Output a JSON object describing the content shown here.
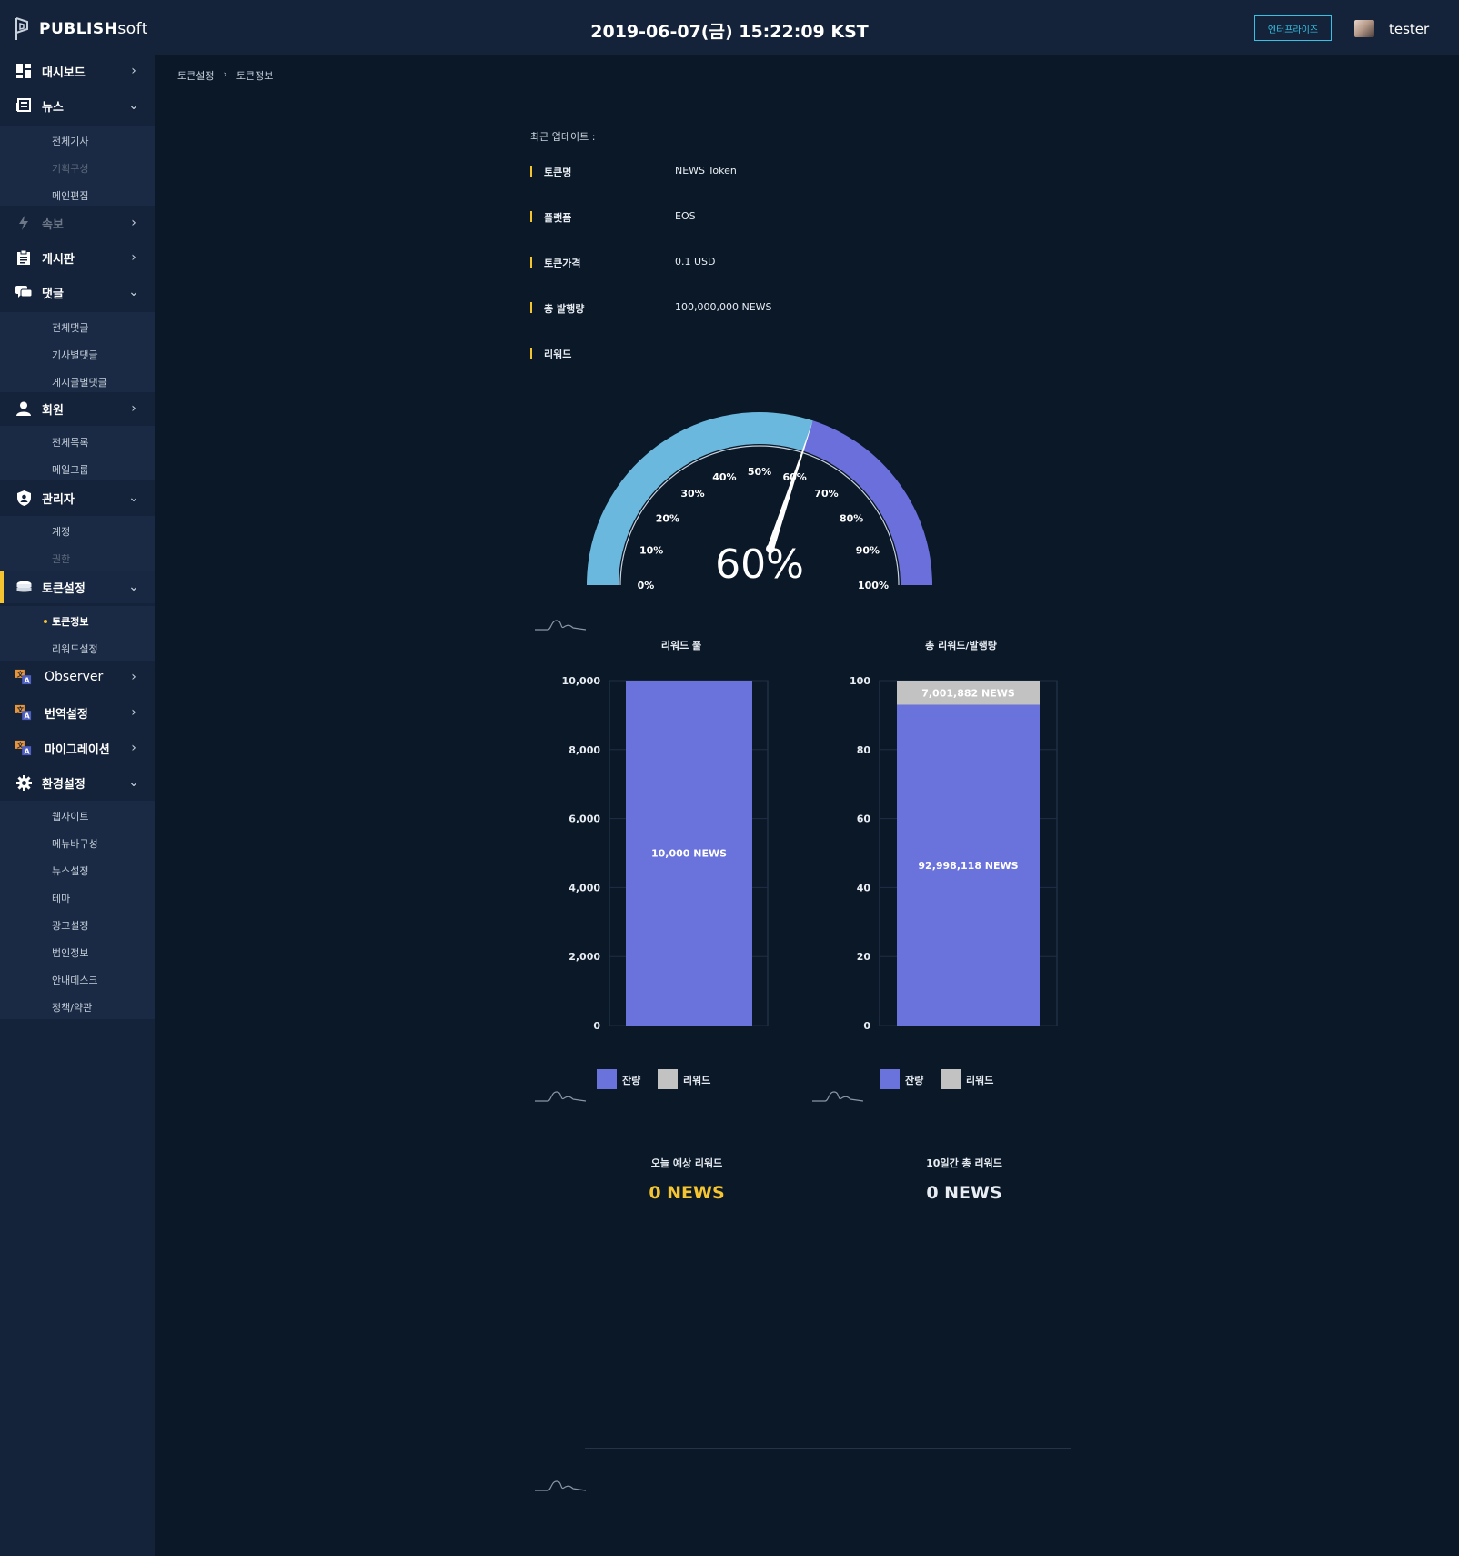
{
  "header": {
    "logo_text_bold": "PUBLISH",
    "logo_text_light": "soft",
    "datetime": "2019-06-07(금) 15:22:09 KST",
    "enterprise_label": "엔터프라이즈",
    "username": "tester"
  },
  "sidebar": {
    "items": [
      {
        "label": "대시보드",
        "icon": "dashboard-icon",
        "chevron": "right"
      },
      {
        "label": "뉴스",
        "icon": "newspaper-icon",
        "chevron": "down",
        "subs": [
          "전체기사",
          "기획구성",
          "메인편집"
        ]
      },
      {
        "label": "속보",
        "icon": "lightning-icon",
        "chevron": "right"
      },
      {
        "label": "게시판",
        "icon": "clipboard-icon",
        "chevron": "right"
      },
      {
        "label": "댓글",
        "icon": "comments-icon",
        "chevron": "down",
        "subs": [
          "전체댓글",
          "기사별댓글",
          "게시글별댓글"
        ]
      },
      {
        "label": "회원",
        "icon": "user-icon",
        "chevron": "right",
        "subs": [
          "전체목록",
          "메일그룹"
        ]
      },
      {
        "label": "관리자",
        "icon": "shield-icon",
        "chevron": "down",
        "subs": [
          "계정",
          "권한"
        ]
      },
      {
        "label": "토큰설정",
        "icon": "coins-icon",
        "chevron": "down",
        "subs": [
          "토큰정보",
          "리워드설정"
        ]
      },
      {
        "label": "Observer",
        "icon": "translate-icon",
        "chevron": "right"
      },
      {
        "label": "번역설정",
        "icon": "translate-icon",
        "chevron": "right"
      },
      {
        "label": "마이그레이션",
        "icon": "translate-icon",
        "chevron": "right"
      },
      {
        "label": "환경설정",
        "icon": "gear-icon",
        "chevron": "down",
        "subs": [
          "웹사이트",
          "메뉴바구성",
          "뉴스설정",
          "테마",
          "광고설정",
          "법인정보",
          "안내데스크",
          "정책/약관"
        ]
      }
    ]
  },
  "breadcrumb": [
    "토큰설정",
    "토큰정보"
  ],
  "token": {
    "updated_label": "최근 업데이트 :",
    "rows": [
      {
        "key": "토큰명",
        "value": "NEWS Token"
      },
      {
        "key": "플랫폼",
        "value": "EOS"
      },
      {
        "key": "토큰가격",
        "value": "0.1 USD"
      },
      {
        "key": "총 발행량",
        "value": "100,000,000 NEWS"
      },
      {
        "key": "리워드",
        "value": ""
      }
    ]
  },
  "colors": {
    "accent_yellow": "#f5c431",
    "gauge_light": "#6ab8dd",
    "gauge_dark": "#6a6fdc",
    "bar_blue": "#6a72dc",
    "bar_grey": "#c2c2c2",
    "enterprise_cyan": "#35c3e5"
  },
  "chart_data": [
    {
      "type": "gauge",
      "value": 60,
      "value_label": "60%",
      "ticks": [
        "0%",
        "10%",
        "20%",
        "30%",
        "40%",
        "50%",
        "60%",
        "70%",
        "80%",
        "90%",
        "100%"
      ],
      "min": 0,
      "max": 100
    },
    {
      "type": "bar",
      "title": "리워드 풀",
      "categories": [
        ""
      ],
      "series": [
        {
          "name": "잔량",
          "values": [
            10000
          ],
          "label": "10,000 NEWS"
        },
        {
          "name": "리워드",
          "values": [
            0
          ]
        }
      ],
      "ylim": [
        0,
        10000
      ],
      "yticks": [
        "0",
        "2,000",
        "4,000",
        "6,000",
        "8,000",
        "10,000"
      ],
      "legend": [
        "잔량",
        "리워드"
      ]
    },
    {
      "type": "bar",
      "title": "총 리워드/발행량",
      "categories": [
        ""
      ],
      "series": [
        {
          "name": "잔량",
          "values": [
            92.998118
          ],
          "label": "92,998,118 NEWS"
        },
        {
          "name": "리워드",
          "values": [
            7.001882
          ],
          "label": "7,001,882 NEWS"
        }
      ],
      "ylim": [
        0,
        100
      ],
      "yticks": [
        "0",
        "20",
        "40",
        "60",
        "80",
        "100"
      ],
      "legend": [
        "잔량",
        "리워드"
      ]
    }
  ],
  "metrics": [
    {
      "title": "오늘 예상 리워드",
      "value": "0 NEWS",
      "color": "#f5c431"
    },
    {
      "title": "10일간 총 리워드",
      "value": "0 NEWS",
      "color": "#e8edf3"
    }
  ]
}
